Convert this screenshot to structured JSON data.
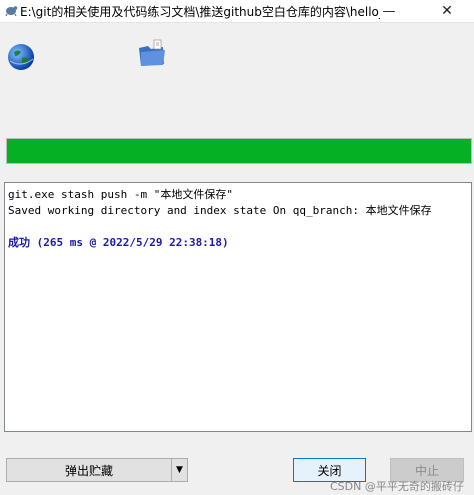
{
  "window": {
    "title": "E:\\git的相关使用及代码练习文档\\推送github空白仓库的内容\\hello_to...",
    "minimize_glyph": "—",
    "close_glyph": "✕"
  },
  "icons": {
    "title": "tortoisegit-turtle-icon",
    "status": "globe-icon",
    "folder": "folder-icon"
  },
  "progress": {
    "fraction": 1.0,
    "color": "#06b025"
  },
  "log": {
    "lines": [
      "git.exe stash push -m \"本地文件保存\"",
      "Saved working directory and index state On qq_branch: 本地文件保存"
    ],
    "success_label": "成功",
    "success_detail": " (265 ms @ 2022/5/29 22:38:18)"
  },
  "buttons": {
    "stash_pop": "弹出贮藏",
    "dropdown": "▼",
    "close": "关闭",
    "abort": "中止"
  },
  "watermark": "CSDN @平平无奇的搬砖仔"
}
